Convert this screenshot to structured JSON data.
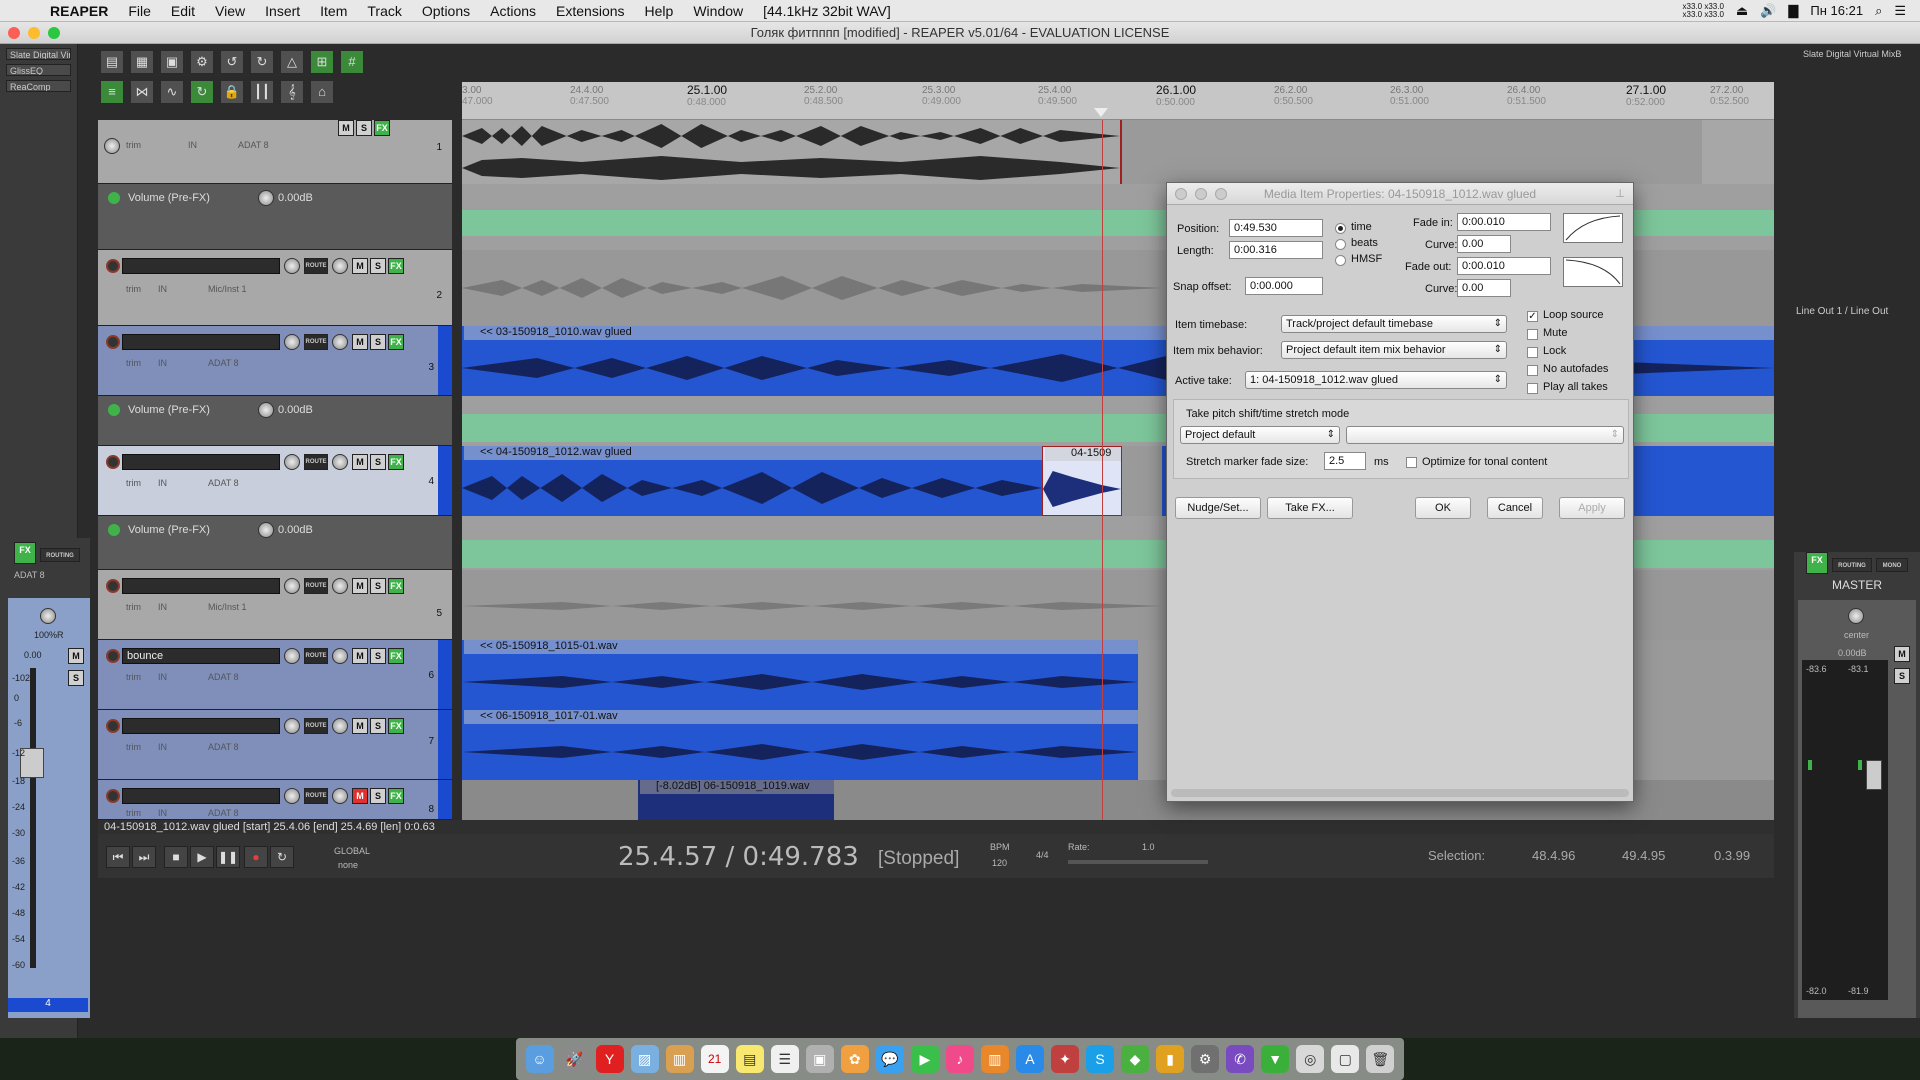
{
  "menubar": {
    "app": "REAPER",
    "items": [
      "File",
      "Edit",
      "View",
      "Insert",
      "Item",
      "Track",
      "Options",
      "Actions",
      "Extensions",
      "Help",
      "Window",
      "[44.1kHz 32bit WAV]"
    ],
    "cpu1": "x33.0 x33.0",
    "cpu2": "x33.0 x33.0",
    "clock": "Пн 16:21"
  },
  "window": {
    "title": "Голяк фитпппп [modified] - REAPER v5.01/64 - EVALUATION LICENSE"
  },
  "leftstrip": {
    "fx": [
      "Slate Digital Virt",
      "GlissEQ",
      "ReaComp"
    ]
  },
  "rightstrip": {
    "fx": "Slate Digital Virtual MixB",
    "io": "Line Out 1 / Line Out"
  },
  "ruler": {
    "marks": [
      {
        "t": "3.00",
        "s": "47.000"
      },
      {
        "t": "24.4.00",
        "s": "0:47.500"
      },
      {
        "t": "25.1.00",
        "s": "0:48.000",
        "major": true
      },
      {
        "t": "25.2.00",
        "s": "0:48.500"
      },
      {
        "t": "25.3.00",
        "s": "0:49.000"
      },
      {
        "t": "25.4.00",
        "s": "0:49.500"
      },
      {
        "t": "26.1.00",
        "s": "0:50.000",
        "major": true
      },
      {
        "t": "26.2.00",
        "s": "0:50.500"
      },
      {
        "t": "26.3.00",
        "s": "0:51.000"
      },
      {
        "t": "26.4.00",
        "s": "0:51.500"
      },
      {
        "t": "27.1.00",
        "s": "0:52.000",
        "major": true
      },
      {
        "t": "27.2.00",
        "s": "0:52.500"
      }
    ]
  },
  "tracks": {
    "t1": {
      "num": "1",
      "input": "ADAT 8",
      "trim": "trim",
      "in": "IN"
    },
    "env1": {
      "name": "Volume (Pre-FX)",
      "db": "0.00dB"
    },
    "t2": {
      "num": "2",
      "input": "Mic/Inst 1",
      "trim": "trim",
      "in": "IN"
    },
    "t3": {
      "num": "3",
      "input": "ADAT 8",
      "trim": "trim",
      "in": "IN"
    },
    "env3": {
      "name": "Volume (Pre-FX)",
      "db": "0.00dB"
    },
    "t4": {
      "num": "4",
      "input": "ADAT 8",
      "trim": "trim",
      "in": "IN"
    },
    "env4": {
      "name": "Volume (Pre-FX)",
      "db": "0.00dB"
    },
    "t5": {
      "num": "5",
      "input": "Mic/Inst 1",
      "trim": "trim",
      "in": "IN"
    },
    "t6": {
      "num": "6",
      "name": "bounce",
      "input": "ADAT 8",
      "trim": "trim",
      "in": "IN"
    },
    "t7": {
      "num": "7",
      "input": "ADAT 8",
      "trim": "trim",
      "in": "IN"
    },
    "t8": {
      "num": "8",
      "input": "ADAT 8",
      "trim": "trim",
      "in": "IN"
    }
  },
  "items": {
    "i3": "<< 03-150918_1010.wav glued",
    "i4": "<< 04-150918_1012.wav glued",
    "i4b": "04-1509",
    "i6": "<< 05-150918_1015-01.wav",
    "i7": "<< 06-150918_1017-01.wav",
    "i8": "[-8.02dB] 06-150918_1019.wav"
  },
  "infobar": "04-150918_1012.wav glued [start] 25.4.06 [end] 25.4.69 [len] 0:0.63",
  "transport": {
    "time": "25.4.57 / 0:49.783",
    "state": "[Stopped]",
    "bpm_label": "BPM",
    "bpm": "120",
    "sig": "4/4",
    "rate_label": "Rate:",
    "rate": "1.0",
    "global": "GLOBAL",
    "none": "none",
    "selection_label": "Selection:",
    "sel_start": "48.4.96",
    "sel_end": "49.4.95",
    "sel_len": "0.3.99"
  },
  "mixer": {
    "left_input": "ADAT 8",
    "left_pan": "100%R",
    "left_db": "0.00",
    "left_num": "4",
    "fx": "FX",
    "routing": "ROUTING",
    "mono": "MONO",
    "master": "MASTER",
    "center": "center",
    "master_db": "0.00dB",
    "peak_l": "-83.6",
    "peak_r": "-83.1",
    "bottom_l": "-82.0",
    "bottom_r": "-81.9",
    "trim": "trim",
    "scale": [
      "-102",
      "0",
      "-6",
      "-12",
      "-18",
      "-24",
      "-30",
      "-36",
      "-42",
      "-48",
      "-54",
      "-60"
    ]
  },
  "dialog": {
    "title": "Media Item Properties:  04-150918_1012.wav glued",
    "position_label": "Position:",
    "position": "0:49.530",
    "length_label": "Length:",
    "length": "0:00.316",
    "mode_time": "time",
    "mode_beats": "beats",
    "mode_hmsf": "HMSF",
    "fadein_label": "Fade in:",
    "fadein": "0:00.010",
    "curve_label": "Curve:",
    "curve_in": "0.00",
    "fadeout_label": "Fade out:",
    "fadeout": "0:00.010",
    "curve_out": "0.00",
    "snap_label": "Snap offset:",
    "snap": "0:00.000",
    "timebase_label": "Item timebase:",
    "timebase": "Track/project default timebase",
    "mix_label": "Item mix behavior:",
    "mix": "Project default item mix behavior",
    "take_label": "Active take:",
    "take": "1: 04-150918_1012.wav glued",
    "loop": "Loop source",
    "mute": "Mute",
    "lock": "Lock",
    "noauto": "No autofades",
    "playall": "Play all takes",
    "pitch_label": "Take pitch shift/time stretch mode",
    "pitch_mode": "Project default",
    "fade_size_label": "Stretch marker fade size:",
    "fade_size": "2.5",
    "ms": "ms",
    "optimize": "Optimize for tonal content",
    "nudge": "Nudge/Set...",
    "takefx": "Take FX...",
    "ok": "OK",
    "cancel": "Cancel",
    "apply": "Apply"
  },
  "dock": {
    "calendar_day": "21"
  },
  "colors": {
    "item_blue": "#2456d2",
    "env_green": "#7dc59a",
    "fx_green": "#3fb34a",
    "select_blue": "#1a4ad0"
  }
}
